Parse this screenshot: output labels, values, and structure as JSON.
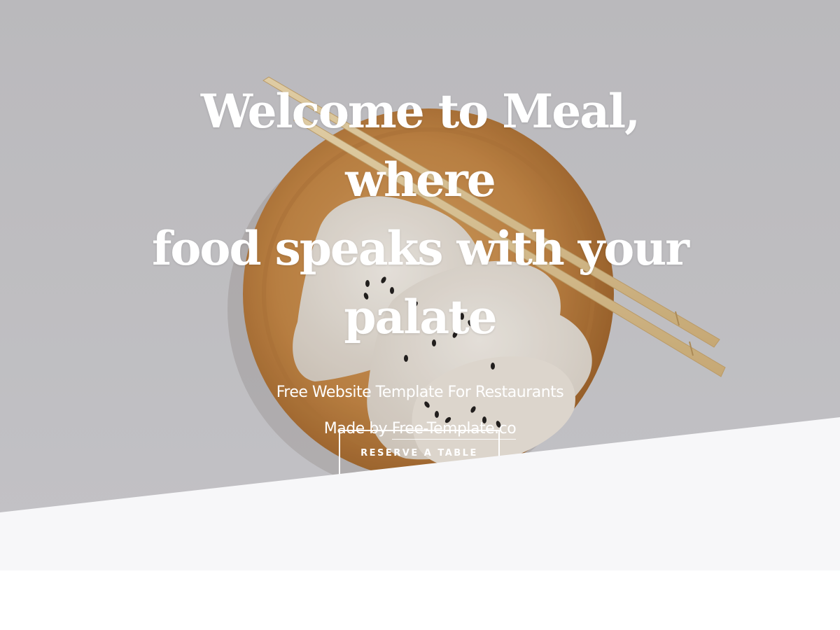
{
  "hero": {
    "title_lines": [
      "Welcome to Meal, where",
      "food speaks with your",
      "palate"
    ],
    "subtitle": "Free Website Template For Restaurants",
    "credit_prefix": "Made by ",
    "credit_link": "Free-Template.co",
    "reserve_label": "RESERVE A TABLE",
    "image_subject": "dumplings-on-wooden-plate-with-chopsticks"
  },
  "colors": {
    "hero_background": "#cbcacd",
    "diagonal_panel": "#f7f7f9",
    "page_background": "#ffffff",
    "text": "#ffffff",
    "plate_wood": "#c78a45",
    "dumpling": "#efe8e0",
    "chopstick": "#e6cc9a"
  }
}
